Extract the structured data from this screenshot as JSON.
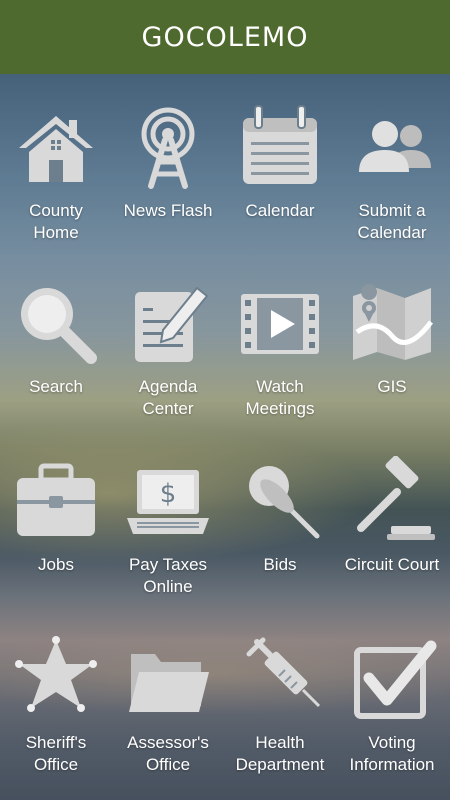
{
  "header": {
    "title": "GOCOLEMO"
  },
  "colors": {
    "header_bg": "#4f6a2f",
    "icon_fill": "#d9d9d9",
    "label": "#ffffff"
  },
  "tiles": [
    {
      "label": "County\nHome",
      "icon": "house-icon"
    },
    {
      "label": "News Flash",
      "icon": "broadcast-tower-icon"
    },
    {
      "label": "Calendar",
      "icon": "calendar-icon"
    },
    {
      "label": "Submit a\nCalendar",
      "icon": "users-icon"
    },
    {
      "label": "Search",
      "icon": "magnifier-icon"
    },
    {
      "label": "Agenda\nCenter",
      "icon": "agenda-edit-icon"
    },
    {
      "label": "Watch\nMeetings",
      "icon": "video-film-icon"
    },
    {
      "label": "GIS",
      "icon": "map-icon"
    },
    {
      "label": "Jobs",
      "icon": "briefcase-icon"
    },
    {
      "label": "Pay Taxes\nOnline",
      "icon": "laptop-dollar-icon"
    },
    {
      "label": "Bids",
      "icon": "pushpin-icon"
    },
    {
      "label": "Circuit Court",
      "icon": "gavel-icon"
    },
    {
      "label": "Sheriff's\nOffice",
      "icon": "sheriff-star-icon"
    },
    {
      "label": "Assessor's\nOffice",
      "icon": "folder-icon"
    },
    {
      "label": "Health\nDepartment",
      "icon": "syringe-icon"
    },
    {
      "label": "Voting\nInformation",
      "icon": "checkbox-icon"
    }
  ]
}
